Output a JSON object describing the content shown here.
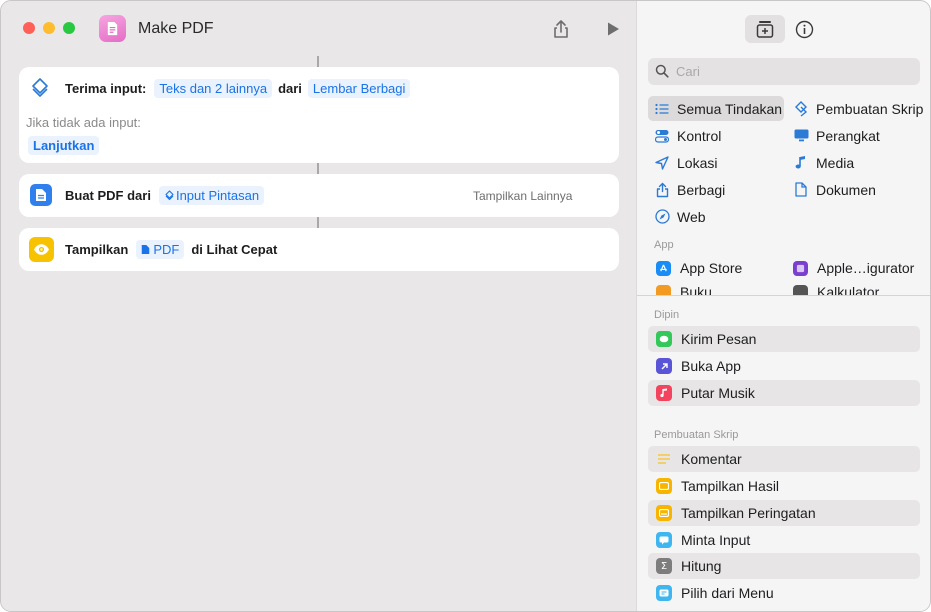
{
  "window": {
    "title": "Make PDF"
  },
  "actions": {
    "receive": {
      "label": "Terima input:",
      "types_token": "Teks dan 2 lainnya",
      "from": "dari",
      "source_token": "Lembar Berbagi",
      "if_none": "Jika tidak ada input:",
      "continue_token": "Lanjutkan"
    },
    "make_pdf": {
      "label": "Buat PDF dari",
      "input_token": "Input Pintasan",
      "show_more": "Tampilkan Lainnya"
    },
    "quick_look": {
      "label": "Tampilkan",
      "pdf_token": "PDF",
      "suffix": "di Lihat Cepat"
    }
  },
  "sidebar": {
    "search": {
      "placeholder": "Cari",
      "value": ""
    },
    "categories": [
      {
        "label": "Semua Tindakan",
        "icon": "list-icon",
        "selected": true
      },
      {
        "label": "Pembuatan Skrip",
        "icon": "scripting-icon"
      },
      {
        "label": "Kontrol",
        "icon": "toggle-icon"
      },
      {
        "label": "Perangkat",
        "icon": "display-icon"
      },
      {
        "label": "Lokasi",
        "icon": "location-icon"
      },
      {
        "label": "Media",
        "icon": "music-note-icon"
      },
      {
        "label": "Berbagi",
        "icon": "share-icon"
      },
      {
        "label": "Dokumen",
        "icon": "document-icon"
      },
      {
        "label": "Web",
        "icon": "compass-icon"
      }
    ],
    "app_section": "App",
    "apps": [
      {
        "label": "App Store",
        "color": "#1a8cf5"
      },
      {
        "label": "Apple…igurator",
        "color": "#7b3fcf"
      },
      {
        "label": "Buku",
        "color": "#f29a22"
      },
      {
        "label": "Kalkulator",
        "color": "#555555"
      }
    ],
    "pinned_section": "Dipin",
    "pinned": [
      {
        "label": "Kirim Pesan",
        "color": "#34c759"
      },
      {
        "label": "Buka App",
        "color": "#5a55d6"
      },
      {
        "label": "Putar Musik",
        "color": "#f4435e"
      }
    ],
    "scripting_section": "Pembuatan Skrip",
    "scripting": [
      {
        "label": "Komentar",
        "color": "#f5d34a"
      },
      {
        "label": "Tampilkan Hasil",
        "color": "#f7b500"
      },
      {
        "label": "Tampilkan Peringatan",
        "color": "#f7b500"
      },
      {
        "label": "Minta Input",
        "color": "#3fb6ef"
      },
      {
        "label": "Hitung",
        "color": "#7d7d7d"
      },
      {
        "label": "Pilih dari Menu",
        "color": "#3fb6ef"
      }
    ]
  }
}
